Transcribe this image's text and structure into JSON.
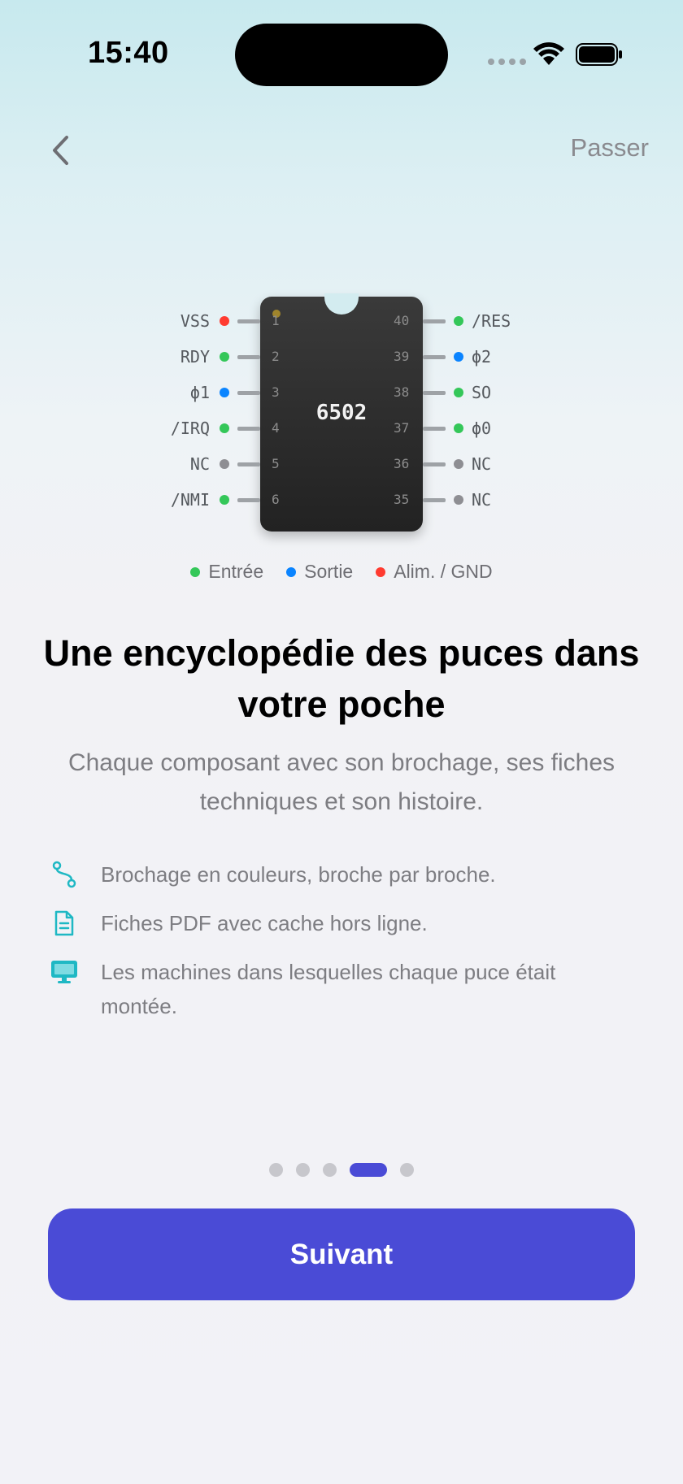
{
  "status_bar": {
    "time": "15:40"
  },
  "nav": {
    "skip_label": "Passer"
  },
  "chip": {
    "name": "6502",
    "left_pins": [
      {
        "label": "VSS",
        "number": "1",
        "type": "power"
      },
      {
        "label": "RDY",
        "number": "2",
        "type": "input"
      },
      {
        "label": "ϕ1",
        "number": "3",
        "type": "output"
      },
      {
        "label": "/IRQ",
        "number": "4",
        "type": "input"
      },
      {
        "label": "NC",
        "number": "5",
        "type": "nc"
      },
      {
        "label": "/NMI",
        "number": "6",
        "type": "input"
      }
    ],
    "right_pins": [
      {
        "label": "/RES",
        "number": "40",
        "type": "input"
      },
      {
        "label": "ϕ2",
        "number": "39",
        "type": "output"
      },
      {
        "label": "SO",
        "number": "38",
        "type": "input"
      },
      {
        "label": "ϕ0",
        "number": "37",
        "type": "input"
      },
      {
        "label": "NC",
        "number": "36",
        "type": "nc"
      },
      {
        "label": "NC",
        "number": "35",
        "type": "nc"
      }
    ]
  },
  "colors": {
    "input": "#34c759",
    "output": "#0a84ff",
    "power": "#ff3b30",
    "nc": "#8e8e93",
    "accent": "#4a4bd6"
  },
  "legend": {
    "input": "Entrée",
    "output": "Sortie",
    "power": "Alim. / GND"
  },
  "content": {
    "title": "Une encyclopédie des puces dans votre poche",
    "subtitle": "Chaque composant avec son brochage, ses fiches techniques et son histoire."
  },
  "features": [
    {
      "icon": "route-icon",
      "text": "Brochage en couleurs, broche par broche."
    },
    {
      "icon": "document-icon",
      "text": "Fiches PDF avec cache hors ligne."
    },
    {
      "icon": "desktop-computer-icon",
      "text": "Les machines dans lesquelles chaque puce était montée."
    }
  ],
  "pager": {
    "total": 5,
    "current": 4
  },
  "cta": {
    "next_label": "Suivant"
  }
}
